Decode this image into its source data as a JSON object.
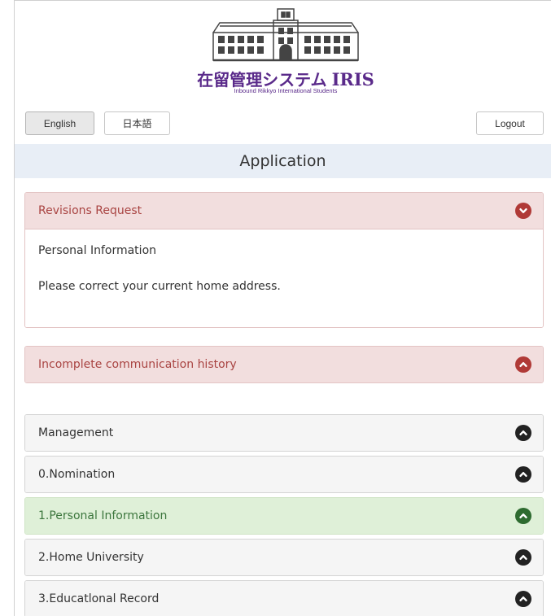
{
  "header": {
    "logo_jp": "在留管理システム",
    "logo_en": "IRIS",
    "logo_sub": "Inbound Rikkyo International Students",
    "lang_english": "English",
    "lang_japanese": "日本語",
    "logout": "Logout"
  },
  "page": {
    "title": "Application"
  },
  "revisions": {
    "title": "Revisions Request",
    "section": "Personal Information",
    "message": "Please correct your current home address."
  },
  "incomplete": {
    "title": "Incomplete communication history"
  },
  "sections": [
    {
      "label": "Management",
      "state": "default"
    },
    {
      "label": "0.Nomination",
      "state": "default"
    },
    {
      "label": "1.Personal Information",
      "state": "success"
    },
    {
      "label": "2.Home University",
      "state": "default"
    },
    {
      "label": "3.Educatlonal Record",
      "state": "default"
    }
  ],
  "colors": {
    "accent_purple": "#5a2a8a",
    "danger_bg": "#f2dede",
    "danger_text": "#a94442",
    "success_bg": "#dff0d8",
    "success_text": "#3c763d",
    "title_bar_bg": "#e8eef6"
  }
}
